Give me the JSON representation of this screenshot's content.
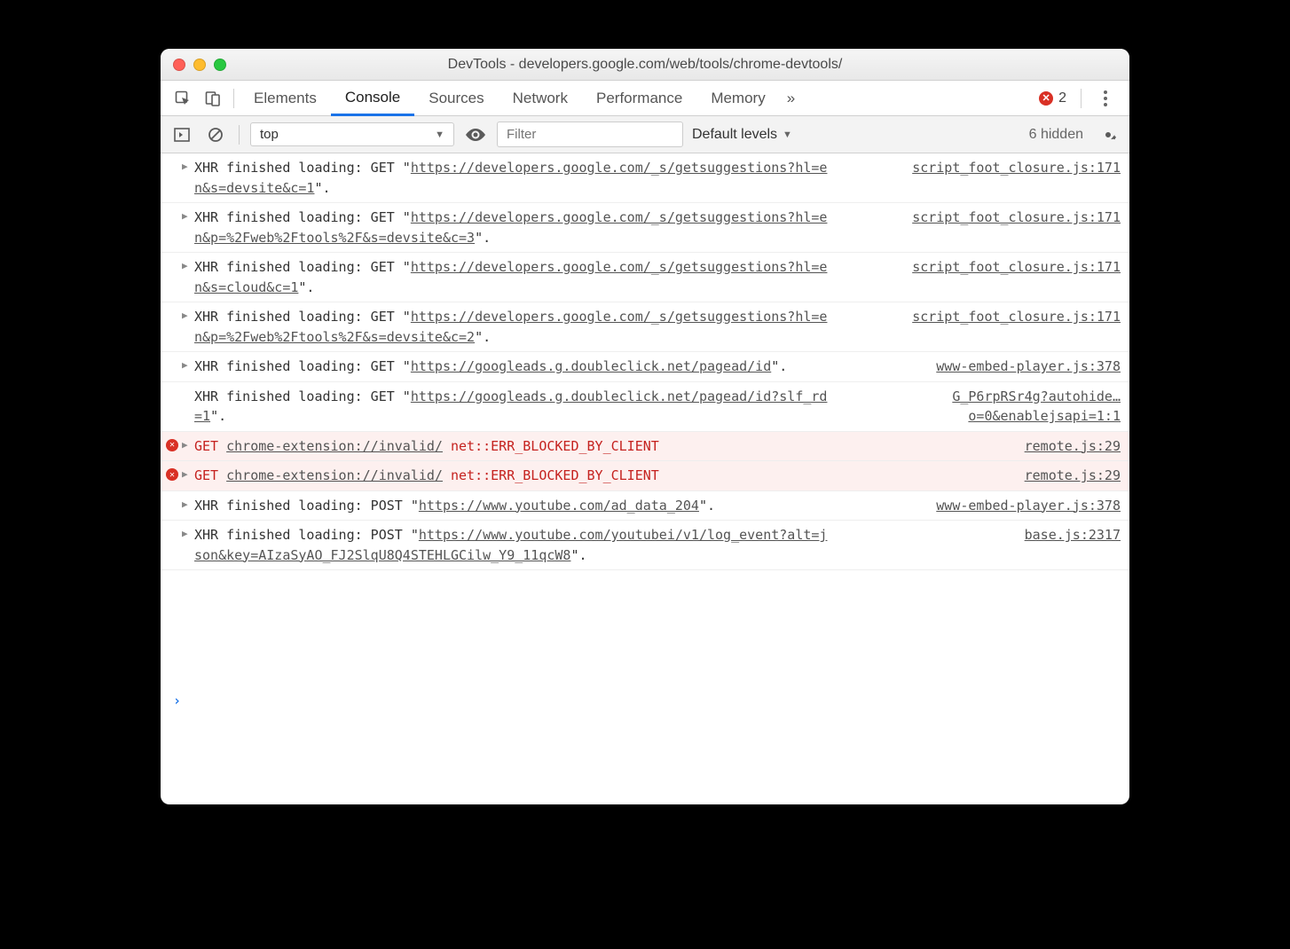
{
  "window": {
    "title": "DevTools - developers.google.com/web/tools/chrome-devtools/"
  },
  "tabs": {
    "items": [
      "Elements",
      "Console",
      "Sources",
      "Network",
      "Performance",
      "Memory"
    ],
    "active": "Console",
    "overflow_glyph": "»",
    "error_count": "2"
  },
  "toolbar": {
    "context": "top",
    "filter_placeholder": "Filter",
    "levels": "Default levels",
    "hidden": "6 hidden"
  },
  "logs": [
    {
      "type": "xhr",
      "caret": true,
      "prefix": "XHR finished loading: GET \"",
      "url": "https://developers.google.com/_s/getsuggestions?hl=en&s=devsite&c=1",
      "suffix": "\".",
      "src": "script_foot_closure.js:171"
    },
    {
      "type": "xhr",
      "caret": true,
      "prefix": "XHR finished loading: GET \"",
      "url": "https://developers.google.com/_s/getsuggestions?hl=en&p=%2Fweb%2Ftools%2F&s=devsite&c=3",
      "suffix": "\".",
      "src": "script_foot_closure.js:171"
    },
    {
      "type": "xhr",
      "caret": true,
      "prefix": "XHR finished loading: GET \"",
      "url": "https://developers.google.com/_s/getsuggestions?hl=en&s=cloud&c=1",
      "suffix": "\".",
      "src": "script_foot_closure.js:171"
    },
    {
      "type": "xhr",
      "caret": true,
      "prefix": "XHR finished loading: GET \"",
      "url": "https://developers.google.com/_s/getsuggestions?hl=en&p=%2Fweb%2Ftools%2F&s=devsite&c=2",
      "suffix": "\".",
      "src": "script_foot_closure.js:171"
    },
    {
      "type": "xhr",
      "caret": true,
      "prefix": "XHR finished loading: GET \"",
      "url": "https://googleads.g.doubleclick.net/pagead/id",
      "suffix": "\".",
      "src": "www-embed-player.js:378"
    },
    {
      "type": "xhr",
      "caret": false,
      "prefix": "XHR finished loading: GET \"",
      "url": "https://googleads.g.doubleclick.net/pagead/id?slf_rd=1",
      "suffix": "\".",
      "src": "G_P6rpRSr4g?autohide…o=0&enablejsapi=1:1"
    },
    {
      "type": "error",
      "caret": true,
      "method": "GET",
      "url": "chrome-extension://invalid/",
      "errtext": "net::ERR_BLOCKED_BY_CLIENT",
      "src": "remote.js:29"
    },
    {
      "type": "error",
      "caret": true,
      "method": "GET",
      "url": "chrome-extension://invalid/",
      "errtext": "net::ERR_BLOCKED_BY_CLIENT",
      "src": "remote.js:29"
    },
    {
      "type": "xhr",
      "caret": true,
      "prefix": "XHR finished loading: POST \"",
      "url": "https://www.youtube.com/ad_data_204",
      "suffix": "\".",
      "src": "www-embed-player.js:378"
    },
    {
      "type": "xhr",
      "caret": true,
      "prefix": "XHR finished loading: POST \"",
      "url": "https://www.youtube.com/youtubei/v1/log_event?alt=json&key=AIzaSyAO_FJ2SlqU8Q4STEHLGCilw_Y9_11qcW8",
      "suffix": "\".",
      "src": "base.js:2317"
    }
  ],
  "prompt": "›"
}
